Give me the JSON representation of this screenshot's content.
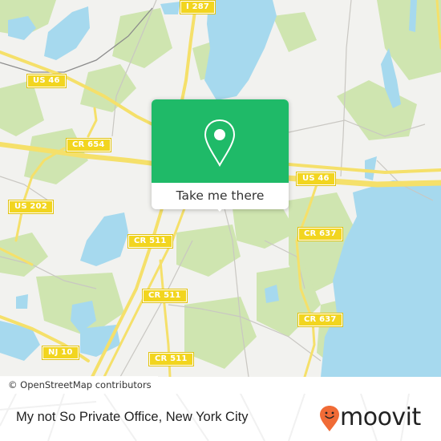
{
  "map": {
    "colors": {
      "land": "#f2f2ef",
      "park": "#cfe5b0",
      "water": "#a6d9ee",
      "road_major": "#f5e06a",
      "road_minor": "#c9c7c2",
      "shield_bg": "#f2d51f",
      "accent_green": "#1fba68",
      "moovit_orange": "#f06b36"
    },
    "road_labels": [
      {
        "id": "i287",
        "text": "I 287"
      },
      {
        "id": "us46-west",
        "text": "US 46"
      },
      {
        "id": "cr654",
        "text": "CR 654"
      },
      {
        "id": "us46-east",
        "text": "US 46"
      },
      {
        "id": "us202",
        "text": "US 202"
      },
      {
        "id": "cr511-a",
        "text": "CR 511"
      },
      {
        "id": "cr637-a",
        "text": "CR 637"
      },
      {
        "id": "cr511-b",
        "text": "CR 511"
      },
      {
        "id": "cr637-b",
        "text": "CR 637"
      },
      {
        "id": "nj10",
        "text": "NJ 10"
      },
      {
        "id": "cr511-c",
        "text": "CR 511"
      }
    ],
    "attribution": "© OpenStreetMap contributors"
  },
  "popup": {
    "icon": "map-pin-icon",
    "button_label": "Take me there"
  },
  "footer": {
    "place_name": "My not So Private Office, New York City",
    "logo_text": "moovit",
    "logo_icon": "moovit-smiley-pin-icon"
  }
}
